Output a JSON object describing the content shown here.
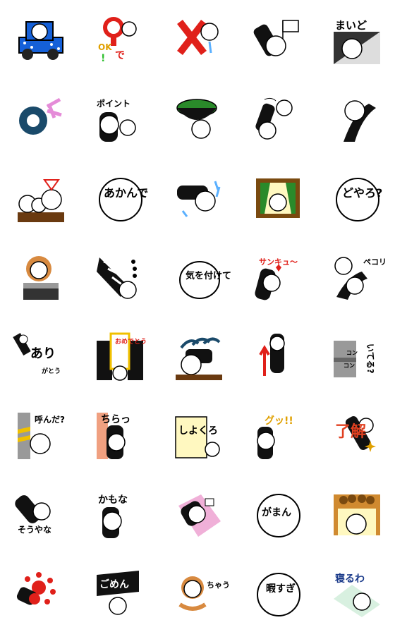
{
  "stickers": [
    {
      "id": "car"
    },
    {
      "id": "ok-de",
      "text1": "OK",
      "text2": "で",
      "mark": "!"
    },
    {
      "id": "x-mark"
    },
    {
      "id": "flag"
    },
    {
      "id": "maido",
      "text": "まいど"
    },
    {
      "id": "o-rolling"
    },
    {
      "id": "point",
      "text": "ポイント"
    },
    {
      "id": "bowl"
    },
    {
      "id": "punch"
    },
    {
      "id": "lean"
    },
    {
      "id": "family"
    },
    {
      "id": "akande",
      "text": "あかんで"
    },
    {
      "id": "splash"
    },
    {
      "id": "picture"
    },
    {
      "id": "doyaro",
      "text": "どやろ?"
    },
    {
      "id": "bear"
    },
    {
      "id": "sliced"
    },
    {
      "id": "ki-wo",
      "text": "気を付けて"
    },
    {
      "id": "thank",
      "text": "サンキュ〜"
    },
    {
      "id": "bow",
      "text": "ペコリ"
    },
    {
      "id": "arigato",
      "text1": "あり",
      "text2": "がとう"
    },
    {
      "id": "omedeto",
      "text": "おめでとう"
    },
    {
      "id": "arrows"
    },
    {
      "id": "rocket"
    },
    {
      "id": "iteru",
      "text1": "いてる?",
      "text2": "コン",
      "text3": "コン"
    },
    {
      "id": "yonda",
      "text": "呼んだ?"
    },
    {
      "id": "chirat",
      "text": "ちらっ"
    },
    {
      "id": "shiyo",
      "text": "しよくろ"
    },
    {
      "id": "good",
      "text": "グッ!!"
    },
    {
      "id": "ryokai",
      "text": "了解"
    },
    {
      "id": "souyana",
      "text": "そうやな"
    },
    {
      "id": "kamona",
      "text": "かもな"
    },
    {
      "id": "sleep-pink"
    },
    {
      "id": "gaman",
      "text": "がまん"
    },
    {
      "id": "curtain"
    },
    {
      "id": "dots"
    },
    {
      "id": "gomen",
      "text": "ごめん"
    },
    {
      "id": "chau",
      "text": "ちゃう"
    },
    {
      "id": "himasugi",
      "text": "暇すぎ"
    },
    {
      "id": "neruwa",
      "text": "寝るわ"
    }
  ]
}
